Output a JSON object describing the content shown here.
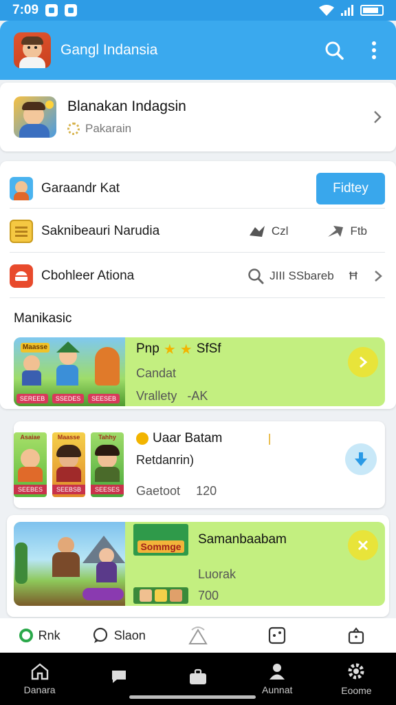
{
  "status": {
    "time": "7:09"
  },
  "app_bar": {
    "title": "Gangl Indansia"
  },
  "featured": {
    "title": "Blanakan Indagsin",
    "subtitle": "Pakarain"
  },
  "list_rows": [
    {
      "label": "Garaandr Kat",
      "button": "Fidtey"
    },
    {
      "label": "Saknibeauri Narudia",
      "meta1": "Czl",
      "meta2": "Ftb"
    },
    {
      "label": "Cbohleer Ationa",
      "meta1": "JIII  SSbareb",
      "meta2": "Ħ"
    }
  ],
  "section": {
    "title": "Manikasic"
  },
  "game_cards": [
    {
      "title": "Pnp",
      "rating_text": "SfSf",
      "line2": "Candat",
      "line3": "Vrallety",
      "line3b": "-AK",
      "thumb_labels": [
        "SEREEB",
        "SSEDES",
        "SEESEB"
      ],
      "thumb_title": "Maasse"
    },
    {
      "title": "Uaar Batam",
      "line2": "Retdanrin)",
      "line3": "Gaetoot",
      "line3b": "120",
      "thumb_labels": [
        "SEEBES",
        "SEEBSB",
        "SEESES"
      ],
      "thumb_titles": [
        "Asaiae",
        "Maasse",
        "Tahhy"
      ]
    },
    {
      "title": "Samanbaabam",
      "line2": "Luorak",
      "line3": "700",
      "badge": "Sommge"
    }
  ],
  "tab_strip": [
    {
      "label": "Rnk"
    },
    {
      "label": "Slaon"
    },
    {
      "label": ""
    },
    {
      "label": ""
    },
    {
      "label": ""
    }
  ],
  "nav_bar": [
    {
      "label": "Danara"
    },
    {
      "label": ""
    },
    {
      "label": ""
    },
    {
      "label": "Aunnat"
    },
    {
      "label": "Eoome"
    }
  ],
  "colors": {
    "accent": "#39a7ec",
    "card_green": "#c3ef80",
    "yellow_btn": "#e8e43a"
  }
}
